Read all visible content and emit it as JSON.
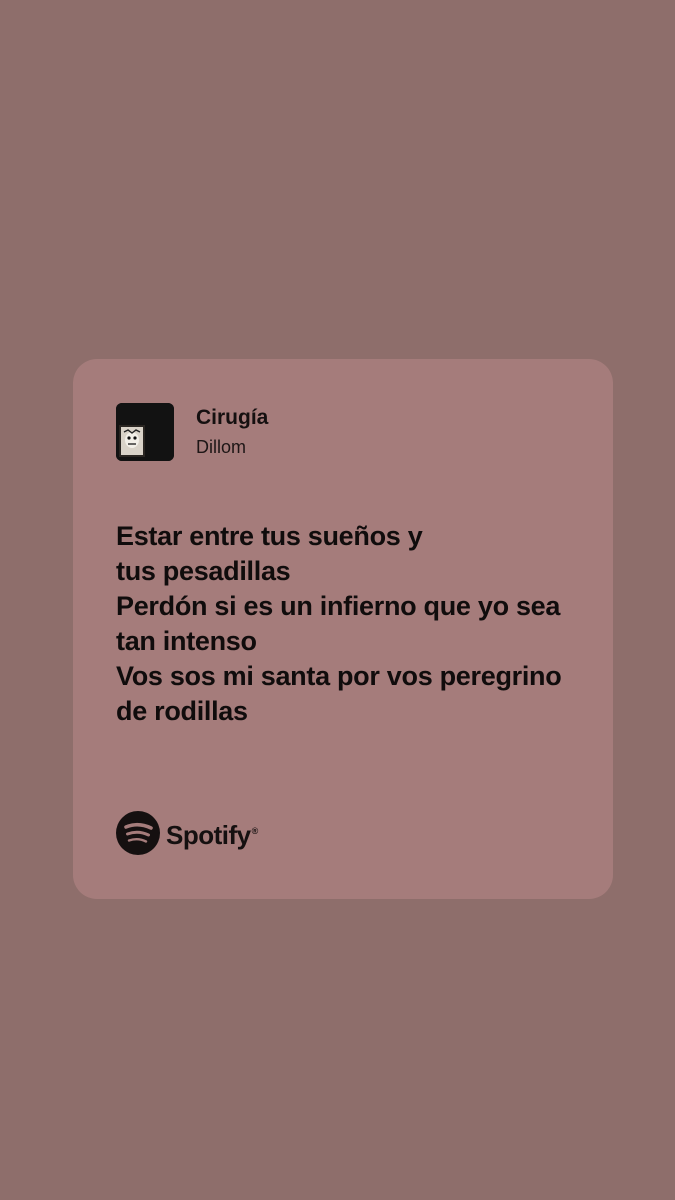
{
  "song": {
    "title": "Cirugía",
    "artist": "Dillom",
    "album_art_icon": "album-cover"
  },
  "lyrics": [
    "Estar entre tus sueños y",
    "tus pesadillas",
    "Perdón si es un infierno que yo sea",
    "tan intenso",
    "Vos sos mi santa por vos peregrino",
    "de rodillas"
  ],
  "brand": {
    "name": "Spotify",
    "icon": "spotify-logo-icon",
    "trademark": "®"
  },
  "colors": {
    "background": "#8e6e6b",
    "card": "#a57c7b",
    "text": "#100c0c"
  }
}
